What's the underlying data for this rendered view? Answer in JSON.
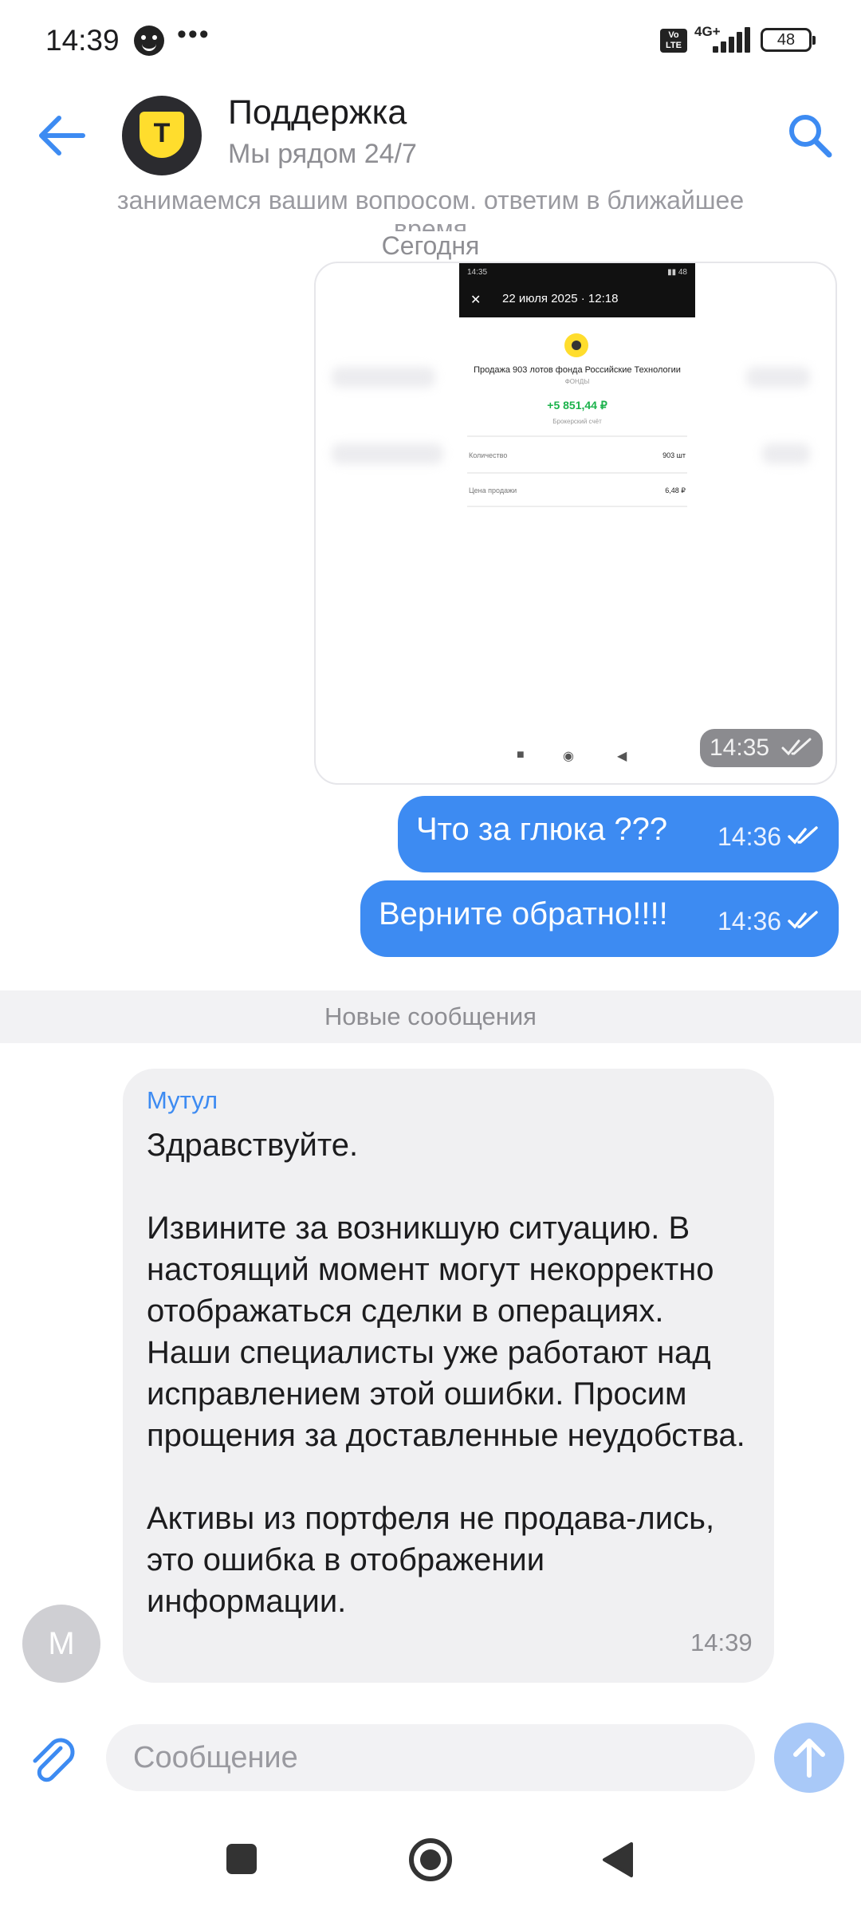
{
  "status_bar": {
    "time": "14:39",
    "more": "•••",
    "volte": "Vo LTE",
    "network": "4G+",
    "battery": "48"
  },
  "header": {
    "title": "Поддержка",
    "subtitle": "Мы рядом 24/7",
    "avatar_letter": "Т"
  },
  "chat": {
    "cut_text_line1": "занимаемся вашим вопросом, ответим в ближайшее",
    "cut_text_line2": "время",
    "date_divider": "Сегодня",
    "image_message": {
      "time": "14:35",
      "screenshot": {
        "status_left": "14:35",
        "status_right": "▮▮ 48",
        "close": "✕",
        "date": "22 июля 2025 · 12:18",
        "title": "Продажа 903 лотов фонда Российские Технологии",
        "category": "ФОНДЫ",
        "amount": "+5 851,44 ₽",
        "account": "Брокерский счёт",
        "rows": [
          {
            "label": "Количество",
            "value": "903 шт"
          },
          {
            "label": "Цена продажи",
            "value": "6,48 ₽"
          }
        ],
        "nav": [
          "■",
          "◉",
          "◀"
        ]
      }
    },
    "outgoing": [
      {
        "text": "Что за глюка ???",
        "time": "14:36"
      },
      {
        "text": "Верните обратно!!!!",
        "time": "14:36"
      }
    ],
    "new_messages_label": "Новые сообщения",
    "incoming": {
      "sender": "Мутул",
      "avatar_letter": "М",
      "text": "Здравствуйте.\n\nИзвините за возникшую ситуацию. В настоящий момент могут некорректно отображаться сделки в операциях. Наши специалисты уже работают над исправлением этой ошибки. Просим прощения за доставленные неудобства.\n\nАктивы из портфеля не продава-лись, это ошибка в отображении информации.",
      "time": "14:39"
    }
  },
  "composer": {
    "placeholder": "Сообщение",
    "value": ""
  },
  "icons": {
    "back": "arrow-left-icon",
    "search": "search-icon",
    "attach": "paperclip-icon",
    "send": "arrow-up-icon"
  },
  "colors": {
    "accent": "#3d8bf2",
    "incoming_bubble": "#f0f0f2",
    "brand_yellow": "#ffdd2d",
    "send_disabled": "#a9c9f8"
  }
}
